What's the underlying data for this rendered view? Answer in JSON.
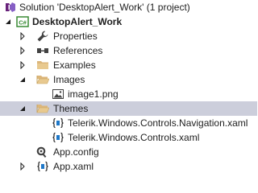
{
  "solution_explorer": {
    "solution": {
      "label": "Solution 'DesktopAlert_Work' (1 project)",
      "icon": "solution-icon"
    },
    "project": {
      "label": "DesktopAlert_Work",
      "icon": "csharp-project-icon",
      "badge": "C#"
    },
    "items": [
      {
        "label": "Properties",
        "icon": "wrench-icon",
        "expanded": false
      },
      {
        "label": "References",
        "icon": "references-icon",
        "expanded": false
      },
      {
        "label": "Examples",
        "icon": "folder-icon",
        "expanded": false
      },
      {
        "label": "Images",
        "icon": "folder-open-icon",
        "expanded": true,
        "children": [
          {
            "label": "image1.png",
            "icon": "image-file-icon"
          }
        ]
      },
      {
        "label": "Themes",
        "icon": "folder-open-icon",
        "expanded": true,
        "selected": true,
        "children": [
          {
            "label": "Telerik.Windows.Controls.Navigation.xaml",
            "icon": "xaml-file-icon"
          },
          {
            "label": "Telerik.Windows.Controls.xaml",
            "icon": "xaml-file-icon"
          }
        ]
      },
      {
        "label": "App.config",
        "icon": "config-file-icon"
      },
      {
        "label": "App.xaml",
        "icon": "xaml-file-icon",
        "expanded": false
      }
    ]
  },
  "colors": {
    "selection": "#cccedb",
    "folder": "#dcb67a",
    "csharp": "#388a34",
    "text": "#1e1e1e"
  }
}
